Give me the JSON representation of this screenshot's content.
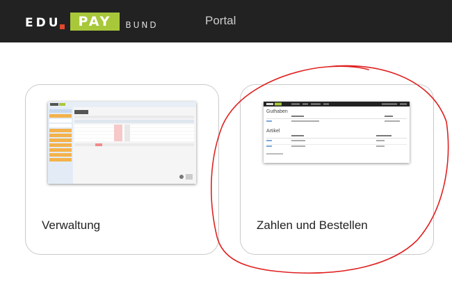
{
  "brand": {
    "edu": "EDU",
    "pay": "PAY",
    "bund": "BUND",
    "colors": {
      "pay_bg": "#a8c83a",
      "dot": "#e0482c",
      "navbar": "#222222"
    }
  },
  "nav": {
    "portal": "Portal"
  },
  "cards": [
    {
      "label": "Verwaltung"
    },
    {
      "label": "Zahlen und Bestellen"
    }
  ],
  "thumb_pay": {
    "section1_title": "Guthaben",
    "section2_title": "Artikel"
  },
  "annotation": {
    "color": "#e02020",
    "shape": "hand-drawn ellipse around Zahlen und Bestellen card"
  }
}
